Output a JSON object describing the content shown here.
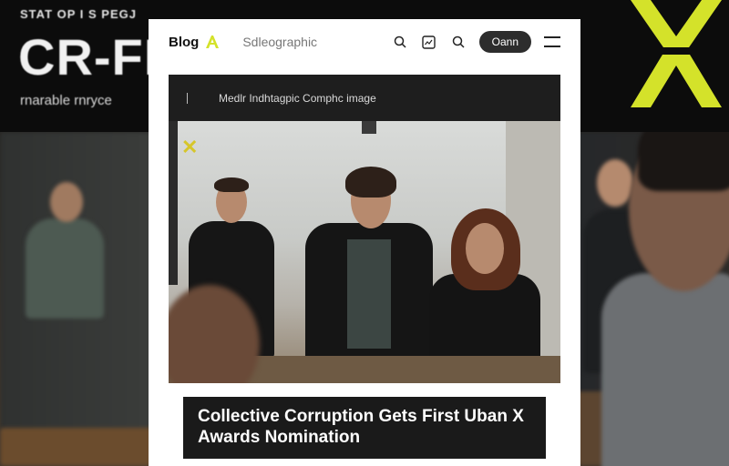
{
  "background": {
    "banner_small_text": "STAT OP I S PEGJ",
    "banner_big_text": "CR-FI",
    "banner_sub_text": "rnarable rnryce",
    "accent_color": "#d4e22a"
  },
  "nav": {
    "brand": "Blog",
    "link": "Sdleographic",
    "pill_label": "Oann",
    "icons": [
      "search-icon",
      "image-icon",
      "search-icon",
      "menu-icon"
    ]
  },
  "hero_bar": {
    "text": "Medlr Indhtagpic Comphc image"
  },
  "article": {
    "headline": "Collective Corruption Gets First Uban X Awards Nomination"
  },
  "colors": {
    "card_bg": "#ffffff",
    "dark_bar": "#1e1e1e",
    "headline_bg": "#1a1a1a",
    "pill_bg": "#2d2d2d"
  }
}
